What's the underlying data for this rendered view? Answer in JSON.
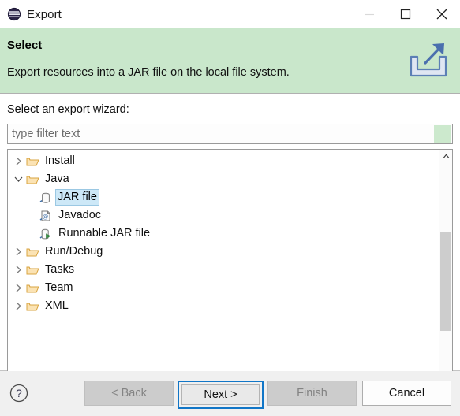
{
  "window": {
    "title": "Export",
    "icon": "eclipse-logo-icon",
    "controls": {
      "minimize": "minimize-icon",
      "maximize": "maximize-icon",
      "close": "close-icon"
    }
  },
  "banner": {
    "title": "Select",
    "description": "Export resources into a JAR file on the local file system.",
    "icon": "export-arrow-icon",
    "background_color": "#c9e7cb"
  },
  "content": {
    "field_label": "Select an export wizard:",
    "filter": {
      "value": "",
      "placeholder": "type filter text",
      "clear_icon": "clear-filter-icon"
    },
    "tree": {
      "selected": "JAR file",
      "nodes": [
        {
          "label": "Install",
          "depth": 1,
          "expanded": false,
          "icon": "folder-icon",
          "selected": false
        },
        {
          "label": "Java",
          "depth": 1,
          "expanded": true,
          "icon": "folder-icon",
          "selected": false
        },
        {
          "label": "JAR file",
          "depth": 2,
          "expanded": null,
          "icon": "jar-file-icon",
          "selected": true
        },
        {
          "label": "Javadoc",
          "depth": 2,
          "expanded": null,
          "icon": "javadoc-icon",
          "selected": false
        },
        {
          "label": "Runnable JAR file",
          "depth": 2,
          "expanded": null,
          "icon": "runnable-jar-icon",
          "selected": false
        },
        {
          "label": "Run/Debug",
          "depth": 1,
          "expanded": false,
          "icon": "folder-icon",
          "selected": false
        },
        {
          "label": "Tasks",
          "depth": 1,
          "expanded": false,
          "icon": "folder-icon",
          "selected": false
        },
        {
          "label": "Team",
          "depth": 1,
          "expanded": false,
          "icon": "folder-icon",
          "selected": false
        },
        {
          "label": "XML",
          "depth": 1,
          "expanded": false,
          "icon": "folder-icon",
          "selected": false
        }
      ]
    },
    "scrollbar": {
      "up_icon": "chevron-up-icon",
      "down_icon": "chevron-down-icon"
    }
  },
  "footer": {
    "help_icon": "help-circle-icon",
    "buttons": [
      {
        "label": "< Back",
        "state": "disabled",
        "default": false
      },
      {
        "label": "Next >",
        "state": "enabled",
        "default": true
      },
      {
        "label": "Finish",
        "state": "disabled",
        "default": false
      },
      {
        "label": "Cancel",
        "state": "enabled",
        "default": false
      }
    ]
  },
  "colors": {
    "banner": "#c9e7cb",
    "selection": "#cde8f7",
    "focus_ring": "#1176c7"
  }
}
